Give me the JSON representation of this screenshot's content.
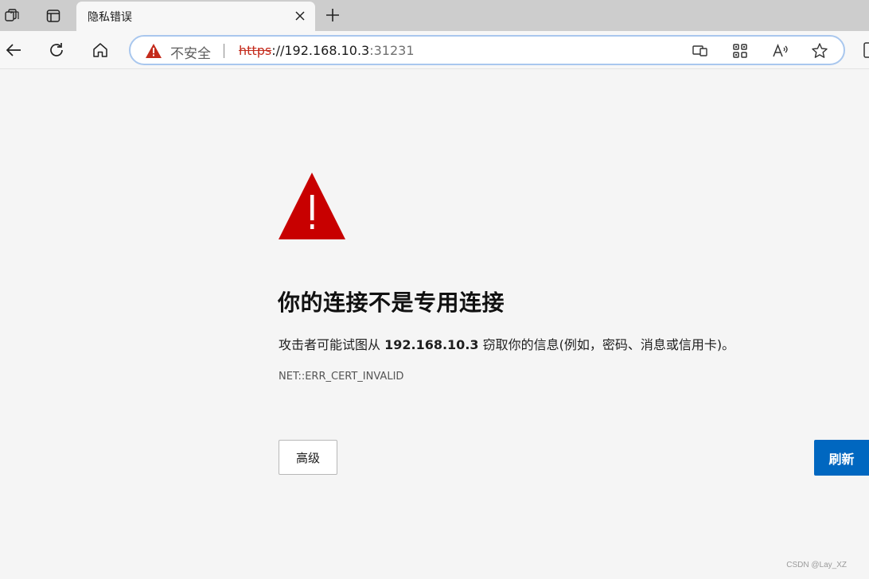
{
  "browser": {
    "tab": {
      "title": "隐私错误",
      "close_symbol": "✕"
    },
    "new_tab_symbol": "+",
    "address_bar": {
      "security_label": "不安全",
      "url_scheme": "https",
      "url_host": "://192.168.10.3",
      "url_port": ":31231"
    },
    "icons": [
      "workspaces-icon",
      "tab-actions-icon",
      "back-icon",
      "refresh-icon",
      "home-icon",
      "app-available-icon",
      "qr-code-icon",
      "read-aloud-icon",
      "favorite-star-icon"
    ]
  },
  "page": {
    "heading": "你的连接不是专用连接",
    "description_prefix": "攻击者可能试图从 ",
    "description_host": "192.168.10.3",
    "description_suffix": " 窃取你的信息(例如，密码、消息或信用卡)。",
    "error_code": "NET::ERR_CERT_INVALID",
    "advanced_button": "高级",
    "refresh_button": "刷新",
    "warning_color": "#c42b1c",
    "accent_color": "#0067c0"
  },
  "watermark": "CSDN @Lay_XZ"
}
